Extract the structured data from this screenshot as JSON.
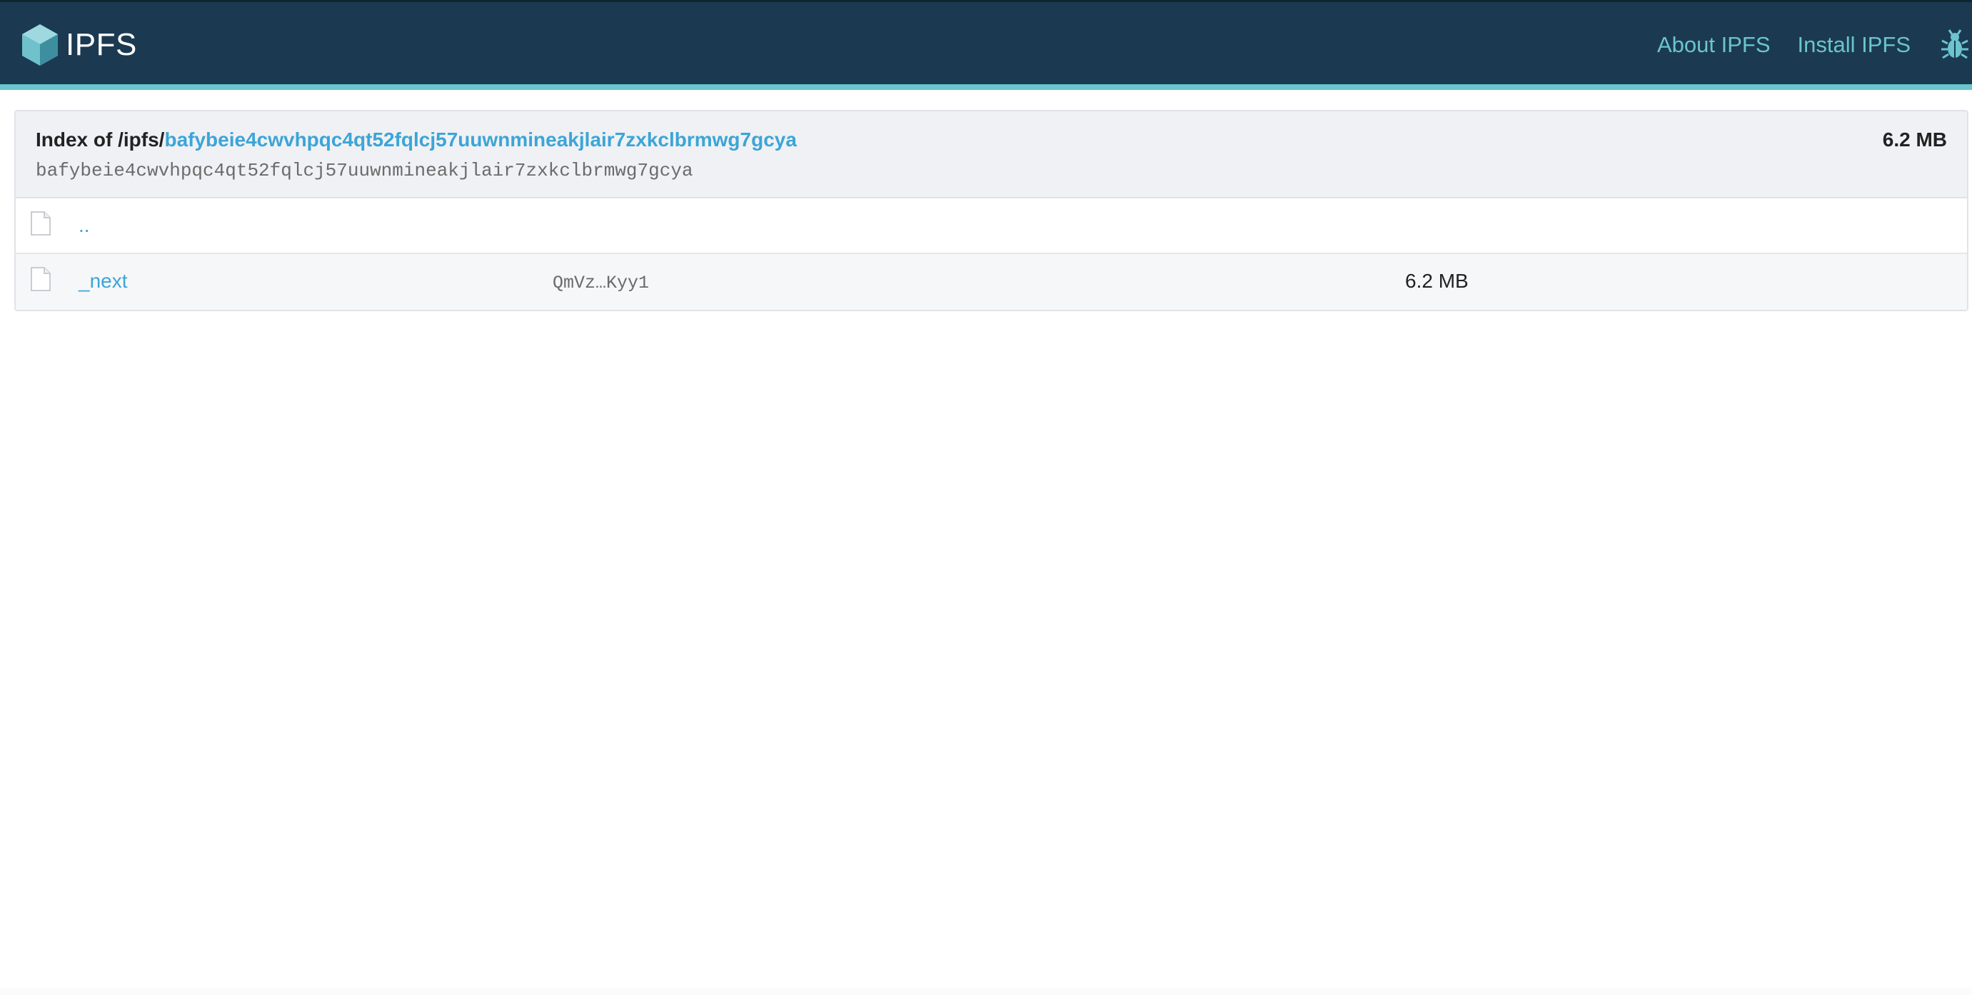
{
  "header": {
    "brand": "IPFS",
    "nav": {
      "about": "About IPFS",
      "install": "Install IPFS"
    },
    "icons": {
      "logo": "ipfs-cube-icon",
      "bug": "bug-icon"
    },
    "colors": {
      "bar": "#1b3a51",
      "accent": "#69c4cd",
      "link": "#3ba5d8"
    }
  },
  "listing": {
    "index_prefix": "Index of /ipfs/",
    "index_link": "bafybeie4cwvhpqc4qt52fqlcj57uuwnmineakjlair7zxkclbrmwg7gcya",
    "cid": "bafybeie4cwvhpqc4qt52fqlcj57uuwnmineakjlair7zxkclbrmwg7gcya",
    "total_size": "6.2 MB",
    "rows": [
      {
        "name": "..",
        "cid": "",
        "size": ""
      },
      {
        "name": "_next",
        "cid": "QmVz…Kyy1",
        "size": "6.2 MB"
      }
    ]
  }
}
